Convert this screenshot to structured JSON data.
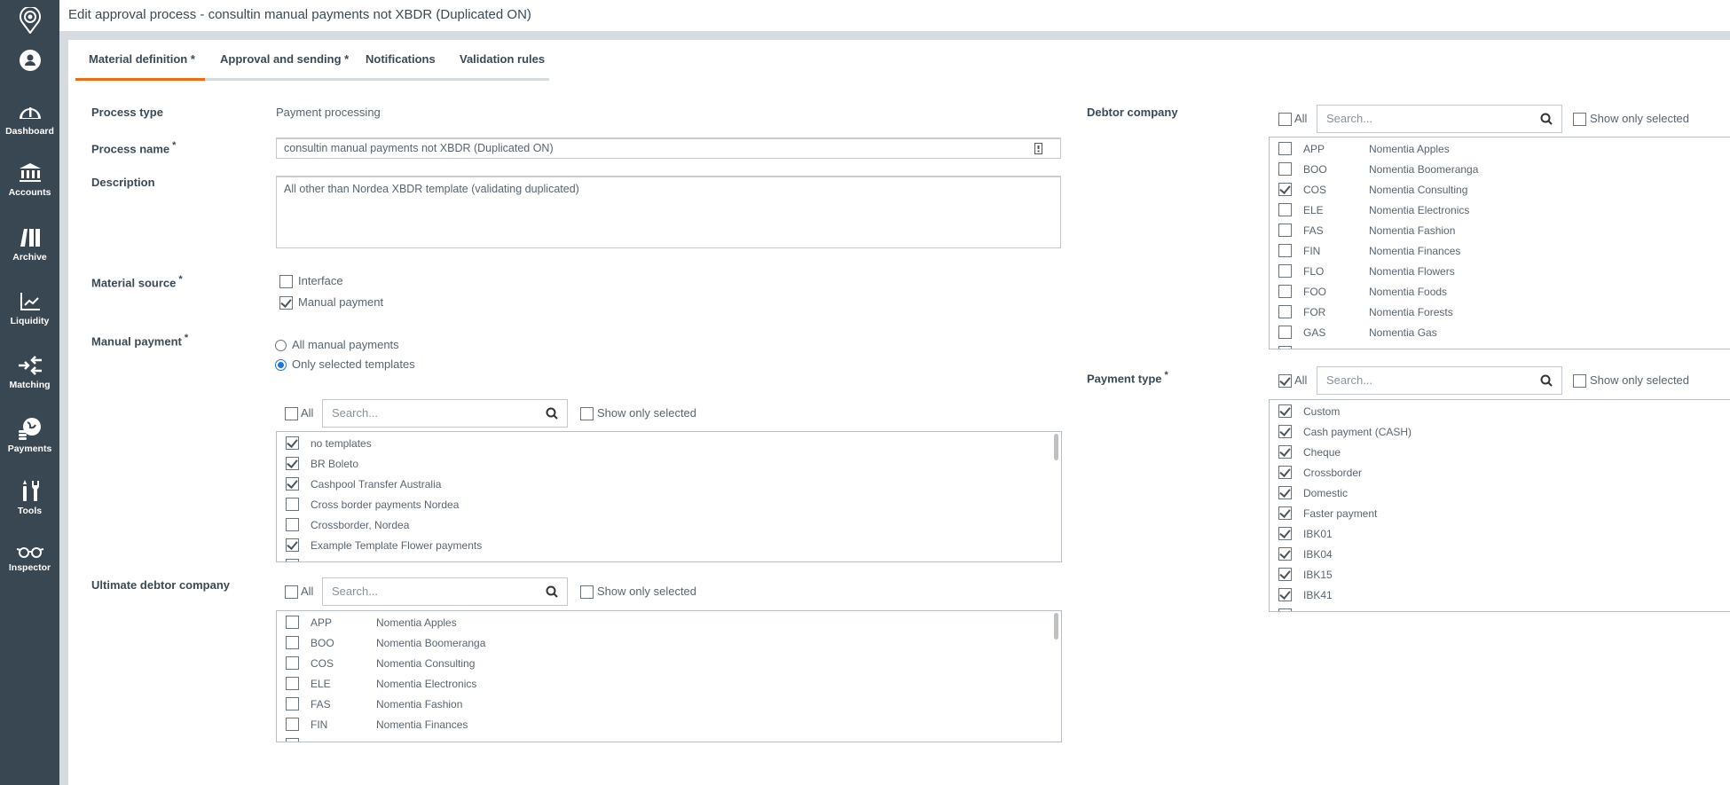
{
  "header": {
    "title": "Edit approval process - consultin manual payments not XBDR (Duplicated ON)"
  },
  "sidebar": {
    "items": [
      {
        "label": "",
        "icon": "location-pin-logo-icon"
      },
      {
        "label": "",
        "icon": "user-avatar-icon"
      },
      {
        "label": "Dashboard",
        "icon": "gauge-icon"
      },
      {
        "label": "Accounts",
        "icon": "bank-icon"
      },
      {
        "label": "Archive",
        "icon": "archive-binders-icon"
      },
      {
        "label": "Liquidity",
        "icon": "line-chart-icon"
      },
      {
        "label": "Matching",
        "icon": "arrows-matching-icon"
      },
      {
        "label": "Payments",
        "icon": "globe-coins-icon"
      },
      {
        "label": "Tools",
        "icon": "tools-icon"
      },
      {
        "label": "Inspector",
        "icon": "glasses-icon"
      }
    ]
  },
  "tabs": [
    {
      "label": "Material definition *",
      "active": true
    },
    {
      "label": "Approval and sending *",
      "active": false
    },
    {
      "label": "Notifications",
      "active": false
    },
    {
      "label": "Validation rules",
      "active": false
    }
  ],
  "colors": {
    "accent": "#f26b0f",
    "sidebar": "#394753",
    "radio": "#1a73e8"
  },
  "form": {
    "process_type": {
      "label": "Process type",
      "value": "Payment processing"
    },
    "process_name": {
      "label": "Process name",
      "required": "*",
      "value": "consultin manual payments not XBDR (Duplicated ON)"
    },
    "description": {
      "label": "Description",
      "value": "All other than Nordea XBDR template (validating duplicated)"
    },
    "material_source": {
      "label": "Material source",
      "required": "*",
      "options": [
        {
          "label": "Interface",
          "checked": false
        },
        {
          "label": "Manual payment",
          "checked": true
        }
      ]
    },
    "manual_payment": {
      "label": "Manual payment",
      "required": "*",
      "options": [
        {
          "label": "All manual payments",
          "selected": false
        },
        {
          "label": "Only selected templates",
          "selected": true
        }
      ]
    },
    "templates": {
      "all_label": "All",
      "all_checked": false,
      "search_placeholder": "Search...",
      "show_only_selected": "Show only selected",
      "items": [
        {
          "name": "no templates",
          "checked": true
        },
        {
          "name": "BR Boleto",
          "checked": true
        },
        {
          "name": "Cashpool Transfer Australia",
          "checked": true
        },
        {
          "name": "Cross border payments Nordea",
          "checked": false
        },
        {
          "name": "Crossborder, Nordea",
          "checked": false
        },
        {
          "name": "Example Template Flower payments",
          "checked": true
        }
      ]
    },
    "ultimate_debtor": {
      "label": "Ultimate debtor company",
      "all_label": "All",
      "all_checked": false,
      "search_placeholder": "Search...",
      "show_only_selected": "Show only selected",
      "items": [
        {
          "code": "APP",
          "name": "Nomentia Apples",
          "checked": false
        },
        {
          "code": "BOO",
          "name": "Nomentia Boomeranga",
          "checked": false
        },
        {
          "code": "COS",
          "name": "Nomentia Consulting",
          "checked": false
        },
        {
          "code": "ELE",
          "name": "Nomentia Electronics",
          "checked": false
        },
        {
          "code": "FAS",
          "name": "Nomentia Fashion",
          "checked": false
        },
        {
          "code": "FIN",
          "name": "Nomentia Finances",
          "checked": false
        }
      ]
    },
    "debtor_company": {
      "label": "Debtor company",
      "all_label": "All",
      "all_checked": false,
      "search_placeholder": "Search...",
      "show_only_selected": "Show only selected",
      "items": [
        {
          "code": "APP",
          "name": "Nomentia Apples",
          "checked": false
        },
        {
          "code": "BOO",
          "name": "Nomentia Boomeranga",
          "checked": false
        },
        {
          "code": "COS",
          "name": "Nomentia Consulting",
          "checked": true
        },
        {
          "code": "ELE",
          "name": "Nomentia Electronics",
          "checked": false
        },
        {
          "code": "FAS",
          "name": "Nomentia Fashion",
          "checked": false
        },
        {
          "code": "FIN",
          "name": "Nomentia Finances",
          "checked": false
        },
        {
          "code": "FLO",
          "name": "Nomentia Flowers",
          "checked": false
        },
        {
          "code": "FOO",
          "name": "Nomentia Foods",
          "checked": false
        },
        {
          "code": "FOR",
          "name": "Nomentia Forests",
          "checked": false
        },
        {
          "code": "GAS",
          "name": "Nomentia Gas",
          "checked": false
        }
      ]
    },
    "payment_type": {
      "label": "Payment type",
      "required": "*",
      "all_label": "All",
      "all_checked": true,
      "search_placeholder": "Search...",
      "show_only_selected": "Show only selected",
      "items": [
        {
          "name": "Custom",
          "checked": true
        },
        {
          "name": "Cash payment (CASH)",
          "checked": true
        },
        {
          "name": "Cheque",
          "checked": true
        },
        {
          "name": "Crossborder",
          "checked": true
        },
        {
          "name": "Domestic",
          "checked": true
        },
        {
          "name": "Faster payment",
          "checked": true
        },
        {
          "name": "IBK01",
          "checked": true
        },
        {
          "name": "IBK04",
          "checked": true
        },
        {
          "name": "IBK15",
          "checked": true
        },
        {
          "name": "IBK41",
          "checked": true
        }
      ]
    }
  }
}
